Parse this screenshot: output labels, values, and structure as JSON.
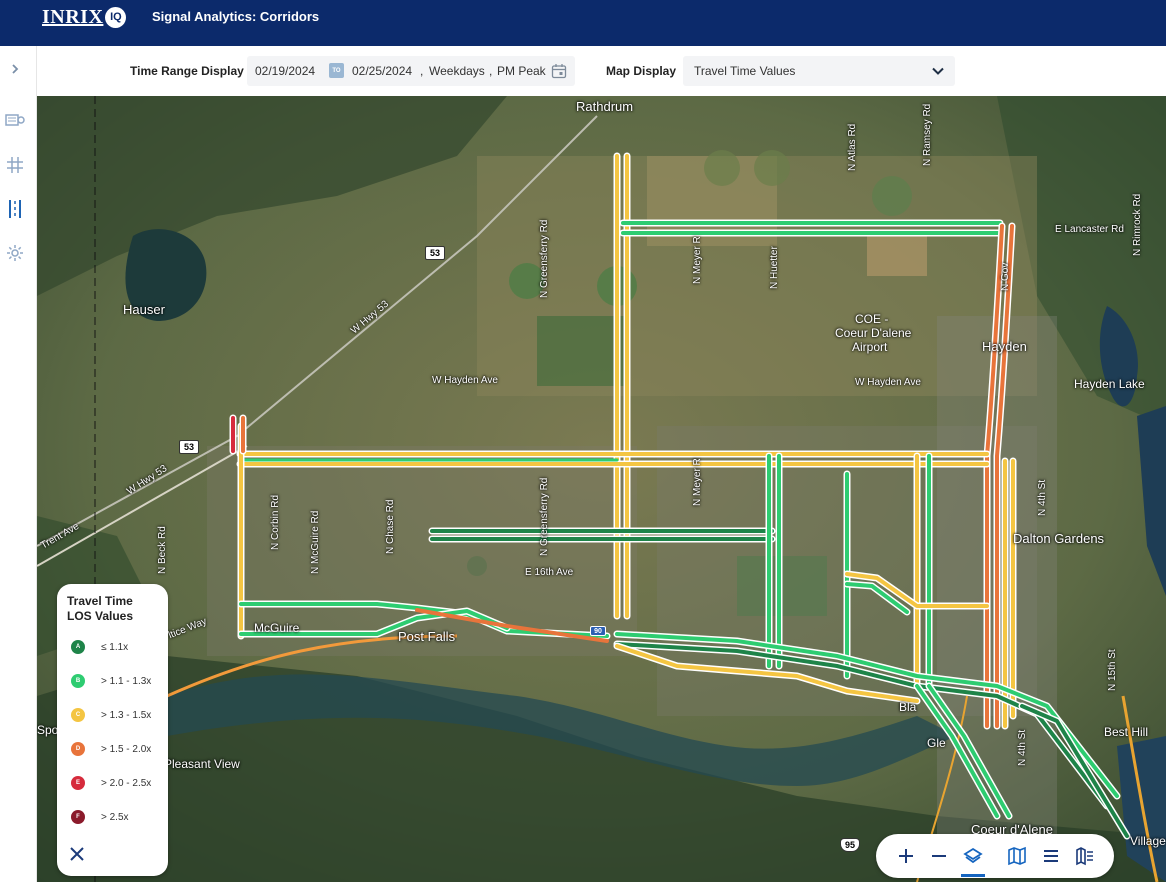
{
  "header": {
    "logo_text": "INRIX",
    "logo_badge": "IQ",
    "title": "Signal Analytics: Corridors"
  },
  "sidebar": {
    "items": [
      {
        "icon": "chevron-right-icon"
      },
      {
        "icon": "signal-dashboard-icon"
      },
      {
        "icon": "intersection-icon"
      },
      {
        "icon": "corridor-icon"
      },
      {
        "icon": "gear-icon"
      }
    ]
  },
  "filters": {
    "time_range_label": "Time Range Display",
    "start_date": "02/19/2024",
    "to_label": "TO",
    "end_date": "02/25/2024",
    "day_type": "Weekdays",
    "period": "PM Peak",
    "map_display_label": "Map Display",
    "map_display_value": "Travel Time Values"
  },
  "map": {
    "places": {
      "rathdrum": "Rathdrum",
      "hauser": "Hauser",
      "coe": "COE -",
      "coe2": "Coeur D'alene",
      "coe3": "Airport",
      "hayden": "Hayden",
      "hayden_lake": "Hayden Lake",
      "dalton": "Dalton Gardens",
      "post_falls": "Post Falls",
      "pleasant_view": "Pleasant View",
      "best_hill": "Best Hill",
      "coeur_dalene": "Coeur d'Alene",
      "mcguire": "McGuire",
      "spo": "Spo",
      "village": "Village",
      "bla": "Bla",
      "gle": "Gle"
    },
    "roads": {
      "w_hayden": "W Hayden Ave",
      "w_hayden_e": "W Hayden Ave",
      "e_lancaster": "E Lancaster Rd",
      "e_16th": "E 16th Ave",
      "n_atlas": "N Atlas Rd",
      "n_ramsey": "N Ramsey Rd",
      "n_huetter": "N Huetter",
      "n_meyer": "N Meyer R",
      "n_meyer2": "N Meyer R",
      "n_greensferry": "N Greensferry Rd",
      "n_greensferry2": "N Greensferry Rd",
      "n_corbin": "N Corbin Rd",
      "n_mcguire": "N McGuire Rd",
      "n_chase": "N Chase Rd",
      "n_beck": "N Beck Rd",
      "n_4th": "N 4th St",
      "n_4th2": "N 4th St",
      "n_15th": "N 15th St",
      "n_rimrock": "N Rimrock Rd",
      "w_hwy53": "W Hwy 53",
      "w_hwy53b": "W Hwy 53",
      "trent": "Trent Ave",
      "seltice": "ltice Way",
      "n_gov": "N Gov"
    },
    "shields": {
      "hwy53a": "53",
      "hwy53b": "53",
      "us95": "95",
      "i90": "90"
    }
  },
  "legend": {
    "title_line1": "Travel Time",
    "title_line2": "LOS Values",
    "items": [
      {
        "grade": "A",
        "label": "≤ 1.1x",
        "color": "#1e8449"
      },
      {
        "grade": "B",
        "label": "> 1.1 - 1.3x",
        "color": "#2ecc71"
      },
      {
        "grade": "C",
        "label": "> 1.3 - 1.5x",
        "color": "#f4c542"
      },
      {
        "grade": "D",
        "label": "> 1.5 - 2.0x",
        "color": "#e8743b"
      },
      {
        "grade": "E",
        "label": "> 2.0 - 2.5x",
        "color": "#d62b3c"
      },
      {
        "grade": "F",
        "label": "> 2.5x",
        "color": "#8b1a2b"
      }
    ]
  },
  "toolbar": {
    "items": [
      "zoom-in-icon",
      "zoom-out-icon",
      "layers-icon",
      "map-icon",
      "list-icon",
      "map-legend-icon"
    ],
    "active": "layers-icon"
  }
}
